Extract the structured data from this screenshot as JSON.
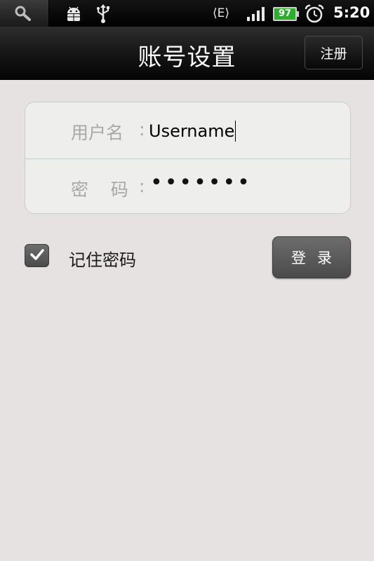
{
  "status_bar": {
    "icons": [
      "search-icon",
      "android-debug-icon",
      "usb-icon",
      "edge-network-icon",
      "signal-icon",
      "battery-icon",
      "alarm-icon"
    ],
    "network": "E",
    "battery": "97",
    "time": "5:20",
    "battery_color": "#2bb02b"
  },
  "header": {
    "title": "账号设置",
    "register_label": "注册"
  },
  "form": {
    "username_label": "用户名",
    "password_label": "密    码",
    "colon": ":",
    "username_value": "Username",
    "password_value": "•••••••"
  },
  "remember": {
    "label": "记住密码",
    "checked": true
  },
  "login": {
    "label": "登录"
  }
}
